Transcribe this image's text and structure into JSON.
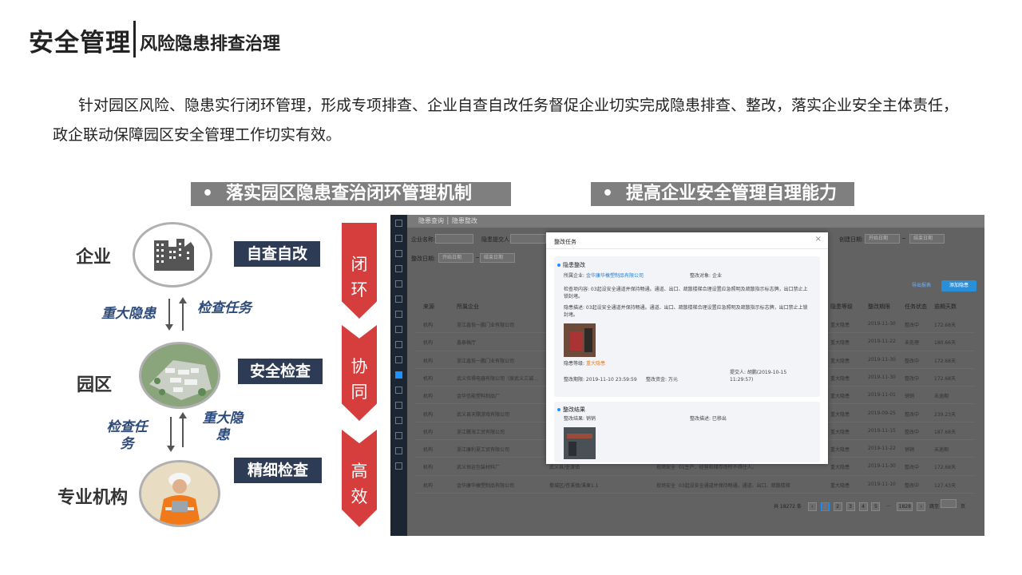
{
  "header": {
    "title": "安全管理",
    "subtitle": "风险隐患排查治理"
  },
  "intro": "针对园区风险、隐患实行闭环管理，形成专项排查、企业自查自改任务督促企业切实完成隐患排查、整改，落实企业安全主体责任，政企联动保障园区安全管理工作切实有效。",
  "sections": {
    "left": "落实园区隐患查治闭环管理机制",
    "right": "提高企业安全管理自理能力",
    "bullet": "•"
  },
  "diagram": {
    "nodes": [
      {
        "label": "企业",
        "tag": "自查自改",
        "icon": "buildings-icon"
      },
      {
        "label": "园区",
        "tag": "安全检查",
        "icon": "park-aerial-photo"
      },
      {
        "label": "专业机构",
        "tag": "精细检查",
        "icon": "worker-photo"
      }
    ],
    "arrows": [
      {
        "up_label": "检查任务",
        "down_label": "重大隐患"
      },
      {
        "up_label": "重大隐患",
        "down_label": "检查任务"
      }
    ],
    "chevrons": [
      "闭环",
      "协同",
      "高效"
    ],
    "chevron_color": "#d63d3d",
    "tag_color": "#2e3b55"
  },
  "app": {
    "breadcrumb": "隐患查询 │ 隐患整改",
    "filters": {
      "company_label": "企业名称:",
      "submitter_label": "隐患提交人:",
      "created_label": "创建日期:",
      "deadline_label": "整改日期:",
      "start_placeholder": "开始日期",
      "end_placeholder": "结束日期",
      "sep": "~"
    },
    "buttons": {
      "export": "导出报表",
      "add": "添加隐患"
    },
    "table": {
      "headers": [
        "来源",
        "所属企业",
        "隐患等级",
        "整改期限",
        "任务状态",
        "逾期天数"
      ],
      "rows": [
        {
          "source": "机构",
          "company": "浙江鑫恢一鹏门业有限公司",
          "extra1": "",
          "extra2": "",
          "extra3": "",
          "level": "重大隐患",
          "date": "2019-11-30",
          "status": "整改中",
          "days": "172.68天"
        },
        {
          "source": "机构",
          "company": "鑫泰稿厅",
          "extra1": "",
          "extra2": "",
          "extra3": "",
          "level": "重大隐患",
          "date": "2019-11-22",
          "status": "未处理",
          "days": "180.66天"
        },
        {
          "source": "机构",
          "company": "浙江鑫恢一鹏门业有限公司",
          "extra1": "",
          "extra2": "",
          "extra3": "",
          "level": "重大隐患",
          "date": "2019-11-30",
          "status": "整改中",
          "days": "172.68天"
        },
        {
          "source": "机构",
          "company": "武义伟得电器有限公司（原武义三诚...",
          "extra1": "",
          "extra2": "",
          "extra3": "",
          "level": "重大隐患",
          "date": "2019-11-30",
          "status": "整改中",
          "days": "172.68天"
        },
        {
          "source": "机构",
          "company": "金华信能塑料制品厂",
          "extra1": "",
          "extra2": "",
          "extra3": "",
          "level": "重大隐患",
          "date": "2019-11-01",
          "status": "销销",
          "days": "未逾期"
        },
        {
          "source": "机构",
          "company": "武义县天騏游戏有限公司",
          "extra1": "",
          "extra2": "",
          "extra3": "",
          "level": "重大隐患",
          "date": "2019-09-25",
          "status": "整改中",
          "days": "239.23天"
        },
        {
          "source": "机构",
          "company": "浙江騰海工贸有限公司",
          "extra1": "",
          "extra2": "",
          "extra3": "",
          "level": "重大隐患",
          "date": "2019-11-15",
          "status": "整改中",
          "days": "187.68天"
        },
        {
          "source": "机构",
          "company": "浙江康利夏工贸有限公司",
          "extra1": "",
          "extra2": "",
          "extra3": "",
          "level": "重大隐患",
          "date": "2019-11-22",
          "status": "销销",
          "days": "未逾期"
        },
        {
          "source": "机构",
          "company": "武义恒运包装材料厂",
          "extra1": "武义县/壶渡镇",
          "extra2": "现场安全",
          "extra3": "01生产、经营和储存场所不得住人。",
          "level": "重大隐患",
          "date": "2019-11-30",
          "status": "整改中",
          "days": "172.68天"
        },
        {
          "source": "机构",
          "company": "金华康华橡塑制品有限公司",
          "extra1": "婺城区/苍溪镇/溪東1.1",
          "extra2": "现场安全",
          "extra3": "03起设安全通道并保持畅通。通道、出口、疏散楼梯",
          "level": "重大隐患",
          "date": "2019-11-10",
          "status": "整改中",
          "days": "127.43天"
        }
      ]
    },
    "pagination": {
      "total": "共 18272 条",
      "prev": "‹",
      "pages": [
        "1",
        "2",
        "3",
        "4",
        "5",
        "···",
        "1828"
      ],
      "next": "›",
      "goto": "跳至",
      "unit": "页"
    },
    "modal": {
      "title": "整改任务",
      "close": "×",
      "section1": "隐患整改",
      "company_label": "所属企业:",
      "company": "金华康华橡塑制品有限公司",
      "object_label": "整改对象:",
      "object": "企业",
      "content": "检查项内容: 03起设安全通道并保持畅通。通道、出口、疏散楼梯合理设置应急照明及疏散指示标志牌，出口禁止上锁封堵。",
      "desc": "隐患描述: 03起设安全通道并保持畅通。通道、出口、疏散楼梯合理设置应急照明及疏散指示标志牌，出口禁止上锁封堵。",
      "level_label": "隐患等级:",
      "level": "重大隐患",
      "deadline": "整改期限: 2019-11-10 23:59:59",
      "funds": "整改资金: 万元",
      "submitter": "提交人: 胡鹏(2019-10-15 11:29:57)",
      "section2": "整改结果",
      "result_label": "整改结果: 销销",
      "result_desc": "整改描述: 已移出"
    }
  }
}
